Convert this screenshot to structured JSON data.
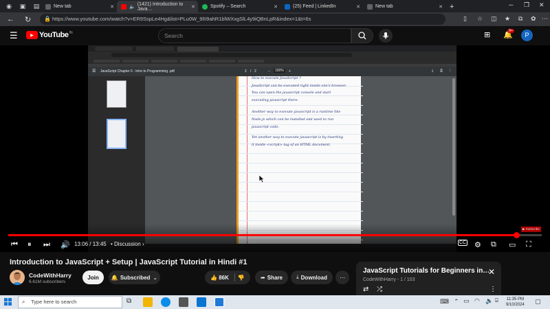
{
  "browser": {
    "tabs": [
      {
        "label": "New tab",
        "favicon_color": "#5f6368",
        "active": false
      },
      {
        "label": "(1421) Introduction to Java…",
        "favicon_color": "#ff0000",
        "active": true
      },
      {
        "label": "Spotify – Search",
        "favicon_color": "#1db954",
        "active": false
      },
      {
        "label": "(25) Feed | LinkedIn",
        "favicon_color": "#0a66c2",
        "active": false
      },
      {
        "label": "New tab",
        "favicon_color": "#5f6368",
        "active": false
      }
    ],
    "url": "https://www.youtube.com/watch?v=ER9SspLe4Hg&list=PLu0W_9lII9ahR1blWXxgSlL4y9iQBnLpR&index=1&t=6s"
  },
  "youtube": {
    "logo_text": "YouTube",
    "logo_region": "IN",
    "search_placeholder": "Search",
    "notification_count": "9+",
    "profile_initial": "P"
  },
  "player": {
    "current_time": "13:06",
    "duration": "13:45",
    "time_separator": " / ",
    "chapter": "Discussion",
    "progress_fraction": 0.952,
    "notebook_lines": [
      "How to execute JavaScript ?",
      "JavaScript can be executed right inside one's browser.",
      "You can open the javascript console and start",
      "executing javascript there.",
      "Another way to execute javascript is a runtime like",
      "Node.js which can be installed and used to run",
      "javascript code.",
      "Yet another way to execute javascript is by inserting",
      "it inside <script> tag of an HTML document."
    ],
    "pdf_title": "JavaScript Chapter 0 - Intro to Programming .pdf",
    "pdf_page": "2",
    "pdf_total": "2",
    "pdf_zoom": "100%"
  },
  "video": {
    "title": "Introduction to JavaScript + Setup | JavaScript Tutorial in Hindi #1",
    "channel": "CodeWithHarry",
    "subscribers": "6.61M subscribers",
    "join_label": "Join",
    "subscribed_label": "Subscribed",
    "likes": "86K",
    "share_label": "Share",
    "download_label": "Download"
  },
  "playlist": {
    "title": "JavaScript Tutorials for Beginners in…",
    "meta": "CodeWithHarry - 1 / 103"
  },
  "taskbar": {
    "search_placeholder": "Type here to search",
    "time": "11:35 PM",
    "date": "9/10/2024"
  }
}
